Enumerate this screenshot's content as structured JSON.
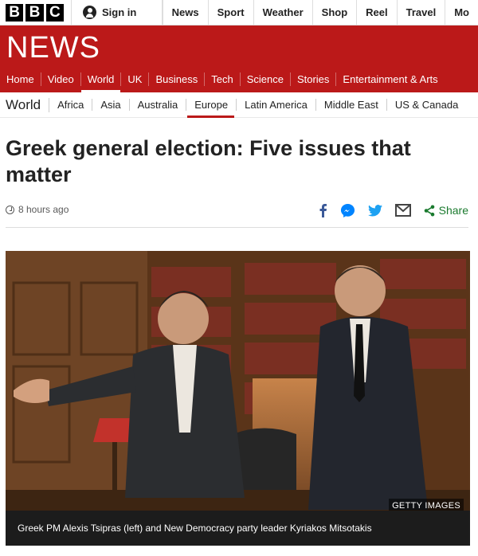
{
  "masthead": {
    "logo_letters": [
      "B",
      "B",
      "C"
    ],
    "signin_label": "Sign in",
    "nav": [
      "News",
      "Sport",
      "Weather",
      "Shop",
      "Reel",
      "Travel",
      "Mo"
    ]
  },
  "news_band": {
    "title": "NEWS",
    "sections": [
      "Home",
      "Video",
      "World",
      "UK",
      "Business",
      "Tech",
      "Science",
      "Stories",
      "Entertainment & Arts"
    ],
    "active_section": "World"
  },
  "subnav": {
    "title": "World",
    "items": [
      "Africa",
      "Asia",
      "Australia",
      "Europe",
      "Latin America",
      "Middle East",
      "US & Canada"
    ],
    "active_item": "Europe"
  },
  "article": {
    "headline": "Greek general election: Five issues that matter",
    "timestamp": "8 hours ago",
    "share_label": "Share",
    "share_icons": [
      "facebook-icon",
      "messenger-icon",
      "twitter-icon",
      "email-icon",
      "share-icon"
    ],
    "image_credit": "GETTY IMAGES",
    "image_caption": "Greek PM Alexis Tsipras (left) and New Democracy party leader Kyriakos Mitsotakis"
  },
  "colors": {
    "brand_red": "#bb1919",
    "share_green": "#1a7a2e",
    "facebook_blue": "#3b5998",
    "twitter_blue": "#1da1f2",
    "messenger_blue": "#0084ff"
  }
}
